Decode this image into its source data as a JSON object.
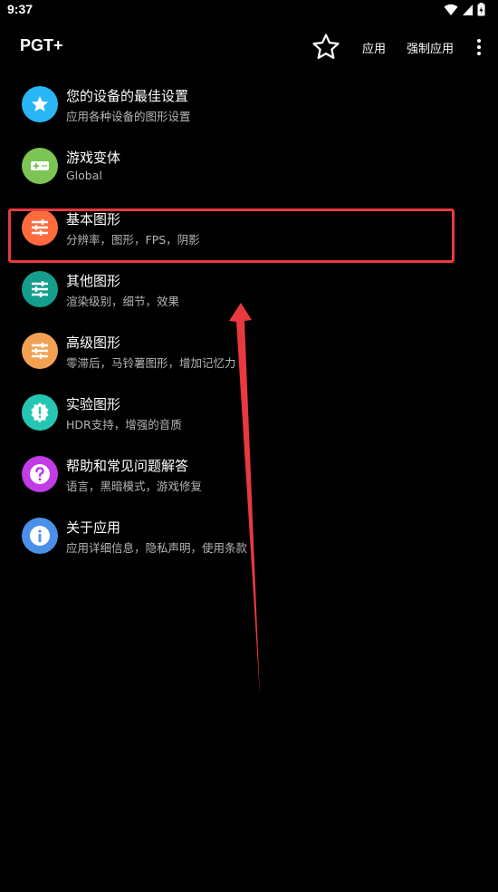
{
  "status_bar": {
    "time": "9:37"
  },
  "app_bar": {
    "title": "PGT+",
    "apply_label": "应用",
    "force_apply_label": "强制应用"
  },
  "menu": {
    "items": [
      {
        "title": "您的设备的最佳设置",
        "subtitle": "应用各种设备的图形设置",
        "icon": "star-icon",
        "color": "#29b6f6"
      },
      {
        "title": "游戏变体",
        "subtitle": "Global",
        "icon": "gamepad-icon",
        "color": "#7cc454"
      },
      {
        "title": "基本图形",
        "subtitle": "分辨率，图形，FPS，阴影",
        "icon": "sliders-icon",
        "color": "#ff6b3d"
      },
      {
        "title": "其他图形",
        "subtitle": "渲染级别，细节，效果",
        "icon": "sliders-icon",
        "color": "#159e8c"
      },
      {
        "title": "高级图形",
        "subtitle": "零滞后，马铃薯图形，增加记忆力",
        "icon": "sliders-icon",
        "color": "#f2a154"
      },
      {
        "title": "实验图形",
        "subtitle": "HDR支持，增强的音质",
        "icon": "alert-badge-icon",
        "color": "#26c6b4"
      },
      {
        "title": "帮助和常见问题解答",
        "subtitle": "语言，黑暗模式，游戏修复",
        "icon": "help-icon",
        "color": "#c13be6"
      },
      {
        "title": "关于应用",
        "subtitle": "应用详细信息，隐私声明，使用条款",
        "icon": "info-icon",
        "color": "#4a90e8"
      }
    ]
  },
  "annotation": {
    "highlight_color": "#e8393e",
    "arrow_color": "#e8393e"
  }
}
